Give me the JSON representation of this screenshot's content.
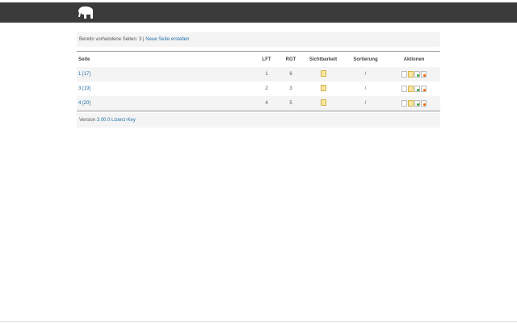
{
  "header": {
    "logo": "elephant-logo"
  },
  "info": {
    "text": "Bereits vorhandene Seiten: 3 |",
    "link": "Neue Seite erstellen"
  },
  "table": {
    "columns": [
      "Seite",
      "LFT",
      "RGT",
      "Sichtbarkeit",
      "Sortierung",
      "Aktionen"
    ],
    "rows": [
      {
        "seite": "1 [17]",
        "lft": "1",
        "rgt": "6",
        "sort": "/"
      },
      {
        "seite": "3 [19]",
        "lft": "2",
        "rgt": "3",
        "sort": "/"
      },
      {
        "seite": "4 [20]",
        "lft": "4",
        "rgt": "5",
        "sort": "/"
      }
    ]
  },
  "footer": {
    "label": "Version",
    "version": "3.00.0",
    "license": "Lizenz-Key"
  }
}
